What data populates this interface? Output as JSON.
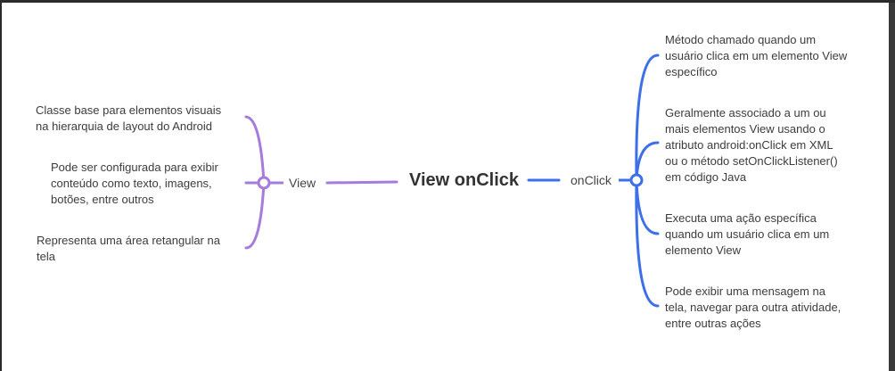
{
  "central_topic": "View onClick",
  "left_branch": {
    "label": "View",
    "color": "#a57bdc",
    "notes": [
      "Classe base para elementos visuais\nna hierarquia de layout do Android",
      "Pode ser configurada para exibir\nconteúdo como texto, imagens,\nbotões, entre outros",
      "Representa uma área retangular na\ntela"
    ]
  },
  "right_branch": {
    "label": "onClick",
    "color": "#3d6fe8",
    "notes": [
      "Método chamado quando um\nusuário clica em um elemento View\nespecífico",
      "Geralmente associado a um ou\nmais elementos View usando o\natributo android:onClick em XML\nou o método setOnClickListener()\nem código Java",
      "Executa uma ação específica\nquando um usuário clica em um\nelemento View",
      "Pode exibir uma mensagem na\ntela, navegar para outra atividade,\nentre outras ações"
    ]
  }
}
